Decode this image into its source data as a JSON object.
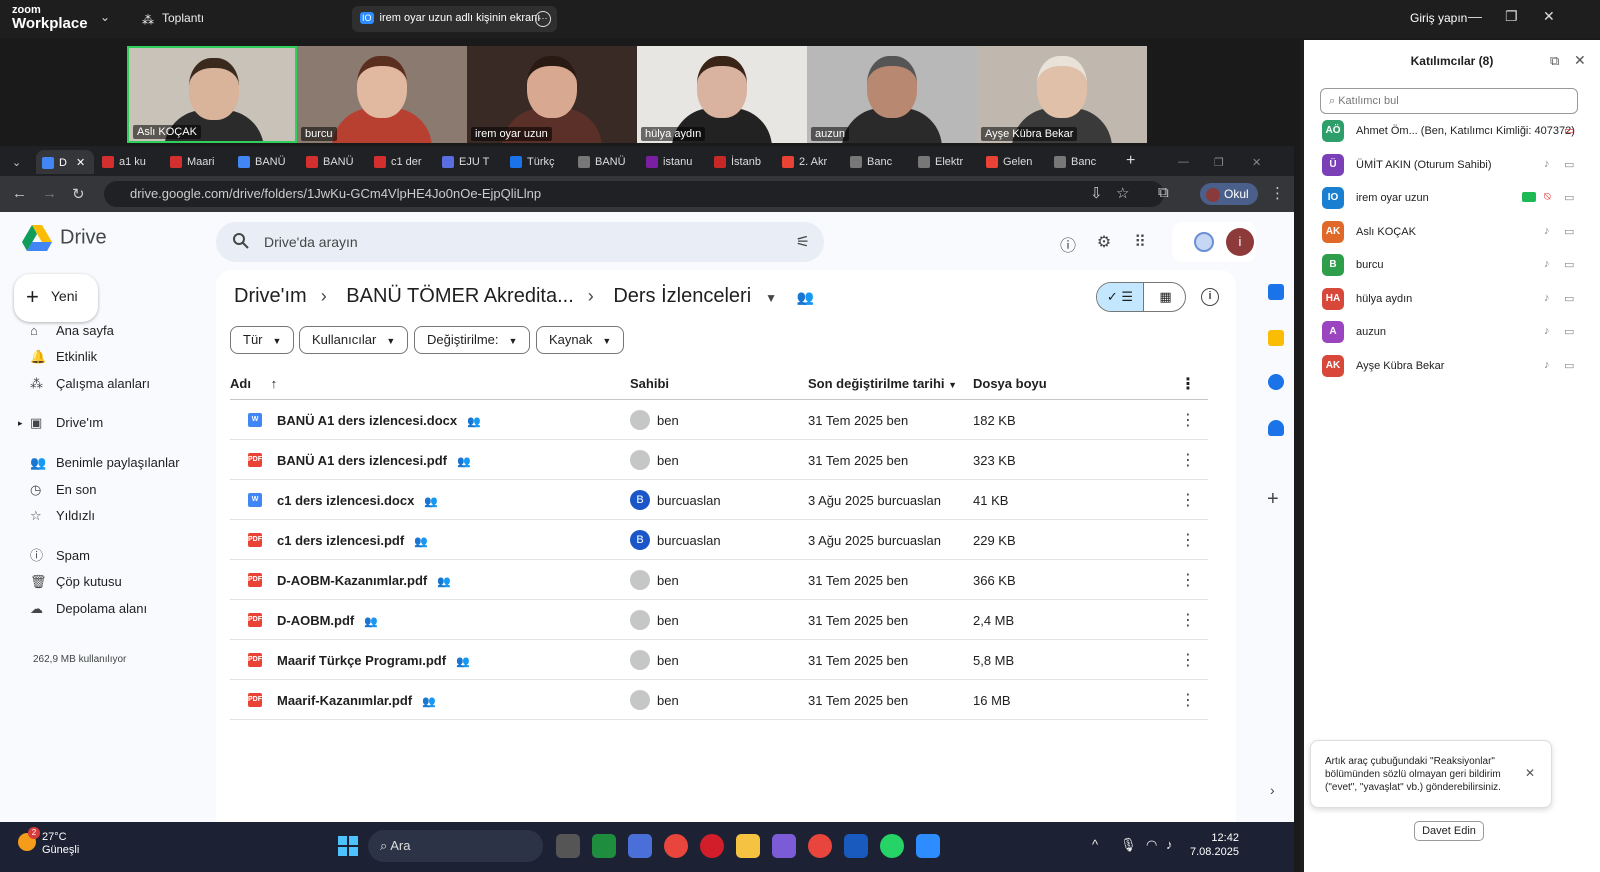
{
  "zoom": {
    "logo_line1": "zoom",
    "logo_line2": "Workplace",
    "meeting_label": "Toplantı",
    "share_badge": "IO",
    "share_label": "irem oyar uzun adlı kişinin ekranı",
    "signin": "Giriş yapın"
  },
  "videos": [
    {
      "name": "Aslı KOÇAK",
      "bg": "#c8c2b8",
      "hair": "#3a2a1e",
      "skin": "#d9b39a",
      "body": "#2b2b2b"
    },
    {
      "name": "burcu",
      "bg": "#8a7a70",
      "hair": "#5a2f1f",
      "skin": "#e0b9a0",
      "body": "#b84030"
    },
    {
      "name": "irem oyar uzun",
      "bg": "#3a2a26",
      "hair": "#2a1a14",
      "skin": "#d8a890",
      "body": "#5a3028"
    },
    {
      "name": "hülya aydın",
      "bg": "#e8e6e2",
      "hair": "#3a2418",
      "skin": "#d9b3a0",
      "body": "#222222"
    },
    {
      "name": "auzun",
      "bg": "#b8b8b8",
      "hair": "#555555",
      "skin": "#b98870",
      "body": "#2a2a2a"
    },
    {
      "name": "Ayşe Kübra Bekar",
      "bg": "#c0b8ae",
      "hair": "#e8e2d8",
      "skin": "#e0c0a8",
      "body": "#3a3a3a"
    }
  ],
  "browser": {
    "tabs": [
      {
        "label": "D",
        "fav": "#4285f4"
      },
      {
        "label": "a1 ku",
        "fav": "#d32f2f"
      },
      {
        "label": "Maari",
        "fav": "#d32f2f"
      },
      {
        "label": "BANÜ",
        "fav": "#4285f4"
      },
      {
        "label": "BANÜ",
        "fav": "#d32f2f"
      },
      {
        "label": "c1 der",
        "fav": "#d32f2f"
      },
      {
        "label": "EJU T",
        "fav": "#5b6ee1"
      },
      {
        "label": "Türkç",
        "fav": "#1a73e8"
      },
      {
        "label": "BANÜ",
        "fav": "#777777"
      },
      {
        "label": "istanu",
        "fav": "#7b1fa2"
      },
      {
        "label": "İstanb",
        "fav": "#c62828"
      },
      {
        "label": "2. Akr",
        "fav": "#ea4335"
      },
      {
        "label": "Banc",
        "fav": "#777777"
      },
      {
        "label": "Elektr",
        "fav": "#777777"
      },
      {
        "label": "Gelen",
        "fav": "#ea4335"
      },
      {
        "label": "Banc",
        "fav": "#777777"
      }
    ],
    "url": "drive.google.com/drive/folders/1JwKu-GCm4VlpHE4Jo0nOe-EjpQliLlnp",
    "profile_label": "Okul"
  },
  "drive": {
    "app_name": "Drive",
    "search_placeholder": "Drive'da arayın",
    "new_label": "Yeni",
    "nav": [
      {
        "label": "Ana sayfa",
        "icon": "⌂"
      },
      {
        "label": "Etkinlik",
        "icon": "🔔"
      },
      {
        "label": "Çalışma alanları",
        "icon": "⁂"
      },
      {
        "label": "Drive'ım",
        "icon": "▣"
      },
      {
        "label": "Benimle paylaşılanlar",
        "icon": "👥"
      },
      {
        "label": "En son",
        "icon": "◷"
      },
      {
        "label": "Yıldızlı",
        "icon": "☆"
      },
      {
        "label": "Spam",
        "icon": "ⓘ"
      },
      {
        "label": "Çöp kutusu",
        "icon": "🗑"
      },
      {
        "label": "Depolama alanı",
        "icon": "☁"
      }
    ],
    "storage_used": "262,9 MB kullanılıyor",
    "breadcrumb": [
      "Drive'ım",
      "BANÜ TÖMER Akredita...",
      "Ders İzlenceleri"
    ],
    "filters": [
      "Tür",
      "Kullanıcılar",
      "Değiştirilme:",
      "Kaynak"
    ],
    "columns": {
      "name": "Adı",
      "owner": "Sahibi",
      "modified": "Son değiştirilme tarihi",
      "size": "Dosya boyu"
    },
    "files": [
      {
        "name": "BANÜ A1 ders izlencesi.docx",
        "type": "W",
        "color": "#4285f4",
        "owner": "ben",
        "owner_initial": "",
        "owner_color": "#c4c7c5",
        "modified": "31 Tem 2025 ben",
        "size": "182 KB"
      },
      {
        "name": "BANÜ A1 ders izlencesi.pdf",
        "type": "PDF",
        "color": "#ea4335",
        "owner": "ben",
        "owner_initial": "",
        "owner_color": "#c4c7c5",
        "modified": "31 Tem 2025 ben",
        "size": "323 KB"
      },
      {
        "name": "c1 ders izlencesi.docx",
        "type": "W",
        "color": "#4285f4",
        "owner": "burcuaslan",
        "owner_initial": "B",
        "owner_color": "#1a56c8",
        "modified": "3 Ağu 2025 burcuaslan",
        "size": "41 KB"
      },
      {
        "name": "c1 ders izlencesi.pdf",
        "type": "PDF",
        "color": "#ea4335",
        "owner": "burcuaslan",
        "owner_initial": "B",
        "owner_color": "#1a56c8",
        "modified": "3 Ağu 2025 burcuaslan",
        "size": "229 KB"
      },
      {
        "name": "D-AOBM-Kazanımlar.pdf",
        "type": "PDF",
        "color": "#ea4335",
        "owner": "ben",
        "owner_initial": "",
        "owner_color": "#c4c7c5",
        "modified": "31 Tem 2025 ben",
        "size": "366 KB"
      },
      {
        "name": "D-AOBM.pdf",
        "type": "PDF",
        "color": "#ea4335",
        "owner": "ben",
        "owner_initial": "",
        "owner_color": "#c4c7c5",
        "modified": "31 Tem 2025 ben",
        "size": "2,4 MB"
      },
      {
        "name": "Maarif Türkçe Programı.pdf",
        "type": "PDF",
        "color": "#ea4335",
        "owner": "ben",
        "owner_initial": "",
        "owner_color": "#c4c7c5",
        "modified": "31 Tem 2025 ben",
        "size": "5,8 MB"
      },
      {
        "name": "Maarif-Kazanımlar.pdf",
        "type": "PDF",
        "color": "#ea4335",
        "owner": "ben",
        "owner_initial": "",
        "owner_color": "#c4c7c5",
        "modified": "31 Tem 2025 ben",
        "size": "16 MB"
      }
    ]
  },
  "taskbar": {
    "temp": "27°C",
    "condition": "Güneşli",
    "notif_count": "2",
    "search_label": "Ara",
    "time": "12:42",
    "date": "7.08.2025"
  },
  "participants": {
    "title": "Katılımcılar (8)",
    "search_placeholder": "Katılımcı bul",
    "list": [
      {
        "initials": "AÖ",
        "name": "Ahmet Öm... (Ben, Katılımcı Kimliği: 407372)",
        "color": "#2e9e6a",
        "mic": "none",
        "cam": "off",
        "sharing": false
      },
      {
        "initials": "Ü",
        "name": "ÜMİT AKIN (Oturum Sahibi)",
        "color": "#7b3fb8",
        "mic": "on",
        "cam": "on",
        "sharing": false
      },
      {
        "initials": "IO",
        "name": "irem oyar uzun",
        "color": "#1a7fd0",
        "mic": "off",
        "cam": "on",
        "sharing": true
      },
      {
        "initials": "AK",
        "name": "Aslı KOÇAK",
        "color": "#e0692a",
        "mic": "on",
        "cam": "on",
        "sharing": false
      },
      {
        "initials": "B",
        "name": "burcu",
        "color": "#2e9e4a",
        "mic": "on",
        "cam": "on",
        "sharing": false
      },
      {
        "initials": "HA",
        "name": "hülya aydın",
        "color": "#d8483a",
        "mic": "on",
        "cam": "on",
        "sharing": false
      },
      {
        "initials": "A",
        "name": "auzun",
        "color": "#9b44c0",
        "mic": "on",
        "cam": "on",
        "sharing": false
      },
      {
        "initials": "AK",
        "name": "Ayşe Kübra Bekar",
        "color": "#d8483a",
        "mic": "on",
        "cam": "on",
        "sharing": false
      }
    ],
    "toast": "Artık araç çubuğundaki \"Reaksiyonlar\" bölümünden sözlü olmayan geri bildirim (\"evet\", \"yavaşlat\" vb.) gönderebilirsiniz.",
    "invite_label": "Davet Edin"
  }
}
